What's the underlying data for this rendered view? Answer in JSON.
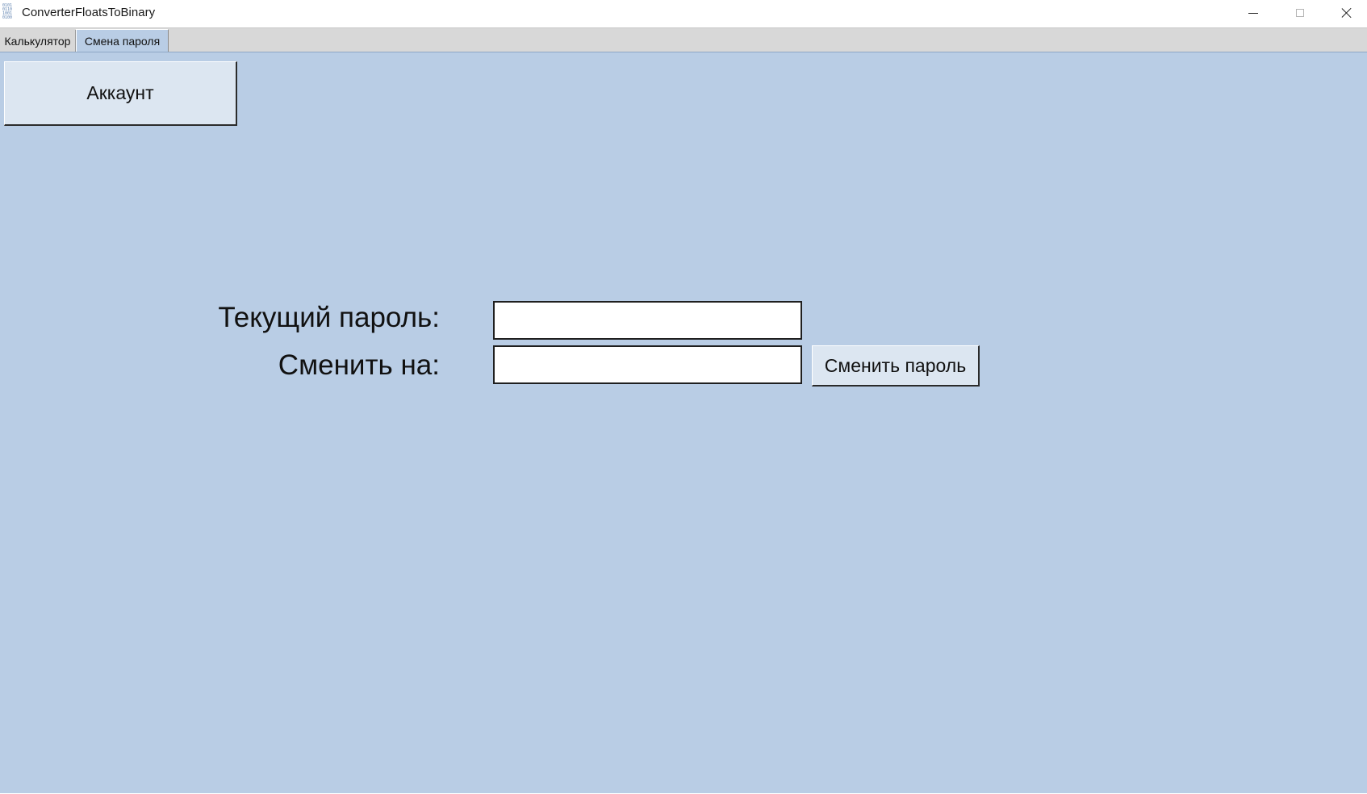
{
  "window": {
    "title": "ConverterFloatsToBinary",
    "icon": "binary-digits-icon",
    "icon_rows": [
      "0101",
      "0110",
      "1001",
      "0100"
    ]
  },
  "tabs": [
    {
      "label": "Калькулятор",
      "active": false
    },
    {
      "label": "Смена пароля",
      "active": true
    }
  ],
  "account": {
    "button_label": "Аккаунт"
  },
  "form": {
    "current_label": "Текущий пароль:",
    "current_value": "",
    "new_label": "Сменить на:",
    "new_value": "",
    "submit_label": "Сменить пароль"
  },
  "colors": {
    "panel_bg": "#b9cde5",
    "button_bg": "#dce6f1",
    "tabstrip_bg": "#d8d8d8"
  }
}
